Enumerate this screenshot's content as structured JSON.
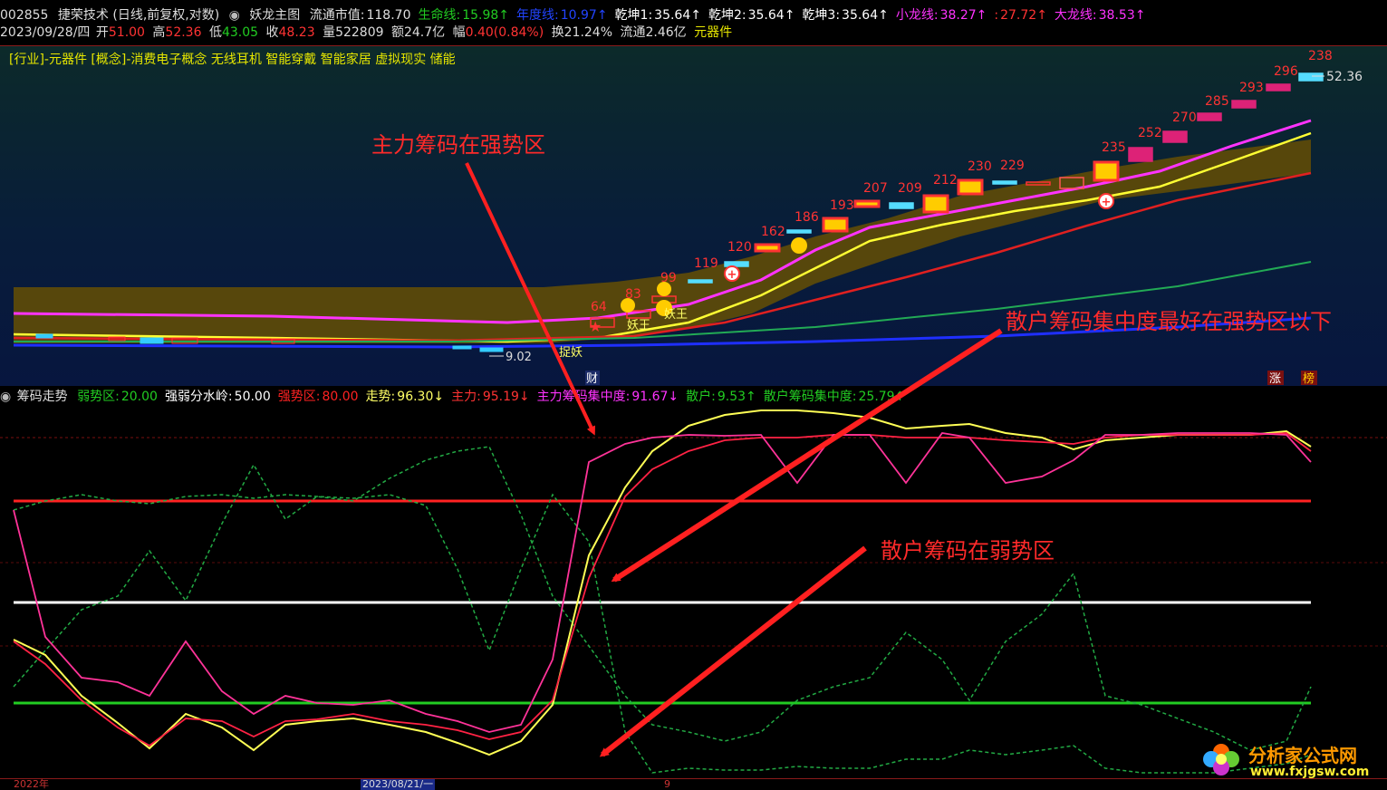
{
  "header1": {
    "code": "002855",
    "name": "捷荣技术",
    "mode": "(日线,前复权,对数)",
    "indicator": "妖龙主图",
    "items": [
      {
        "label": "流通市值:",
        "value": "118.70",
        "color": "#e0e0e0"
      },
      {
        "label": "生命线:",
        "value": "15.98↑",
        "color": "#22cc22"
      },
      {
        "label": "年度线:",
        "value": "10.97↑",
        "color": "#2244ff"
      },
      {
        "label": "乾坤1:",
        "value": "35.64↑",
        "color": "#ffffff"
      },
      {
        "label": "乾坤2:",
        "value": "35.64↑",
        "color": "#ffffff"
      },
      {
        "label": "乾坤3:",
        "value": "35.64↑",
        "color": "#ffffff"
      },
      {
        "label": "小龙线:",
        "value": "38.27↑",
        "color": "#ff33ff"
      },
      {
        "label": ":",
        "value": "27.72↑",
        "color": "#ff3333"
      },
      {
        "label": "大龙线:",
        "value": "38.53↑",
        "color": "#ff33ff"
      }
    ]
  },
  "header2": {
    "date": "2023/09/28/四",
    "open_label": "开",
    "open": "51.00",
    "high_label": "高",
    "high": "52.36",
    "low_label": "低",
    "low": "43.05",
    "close_label": "收",
    "close": "48.23",
    "vol_label": "量",
    "vol": "522809",
    "amt_label": "额",
    "amt": "24.7亿",
    "chg_label": "幅",
    "chg": "0.40(0.84%)",
    "turn_label": "换",
    "turn": "21.24%",
    "float_label": "流通",
    "float": "2.46亿",
    "sector": "元器件"
  },
  "sectors_line": "[行业]-元器件 [概念]-消费电子概念 无线耳机 智能穿戴 智能家居 虚拟现实 储能",
  "price_labels": {
    "last_price": "52.36",
    "low_price": "9.02",
    "candle_numbers": [
      "64",
      "83",
      "99",
      "119",
      "120",
      "162",
      "186",
      "193",
      "207",
      "209",
      "212",
      "230",
      "229",
      "235",
      "252",
      "270",
      "285",
      "293",
      "296",
      "238"
    ],
    "badges": [
      "妖王",
      "妖王",
      "捉妖"
    ],
    "bottom_marks": [
      "财",
      "涨",
      "榜"
    ]
  },
  "lower_header": {
    "indicator_name": "筹码走势",
    "items": [
      {
        "label": "弱势区:",
        "value": "20.00",
        "color": "#22cc22"
      },
      {
        "label": "强弱分水岭:",
        "value": "50.00",
        "color": "#ffffff"
      },
      {
        "label": "强势区:",
        "value": "80.00",
        "color": "#ff2222"
      },
      {
        "label": "走势:",
        "value": "96.30↓",
        "color": "#ffff66"
      },
      {
        "label": "主力:",
        "value": "95.19↓",
        "color": "#ff3333"
      },
      {
        "label": "主力筹码集中度:",
        "value": "91.67↓",
        "color": "#ff33ff"
      },
      {
        "label": "散户:",
        "value": "9.53↑",
        "color": "#22cc22"
      },
      {
        "label": "散户筹码集中度:",
        "value": "25.79↑",
        "color": "#22cc22"
      }
    ]
  },
  "annotations": {
    "a1": "主力筹码在强势区",
    "a2": "散户筹码集中度最好在强势区以下",
    "a3": "散户筹码在弱势区"
  },
  "footer": {
    "year": "2022年",
    "date": "2023/08/21/一",
    "mark": "9"
  },
  "logo": {
    "title": "分析家公式网",
    "url": "www.fxjgsw.com"
  },
  "colors": {
    "up": "#ff3333",
    "down": "#33ccff",
    "strong": "#ff2222",
    "weak": "#22cc22",
    "divide": "#ffffff"
  }
}
